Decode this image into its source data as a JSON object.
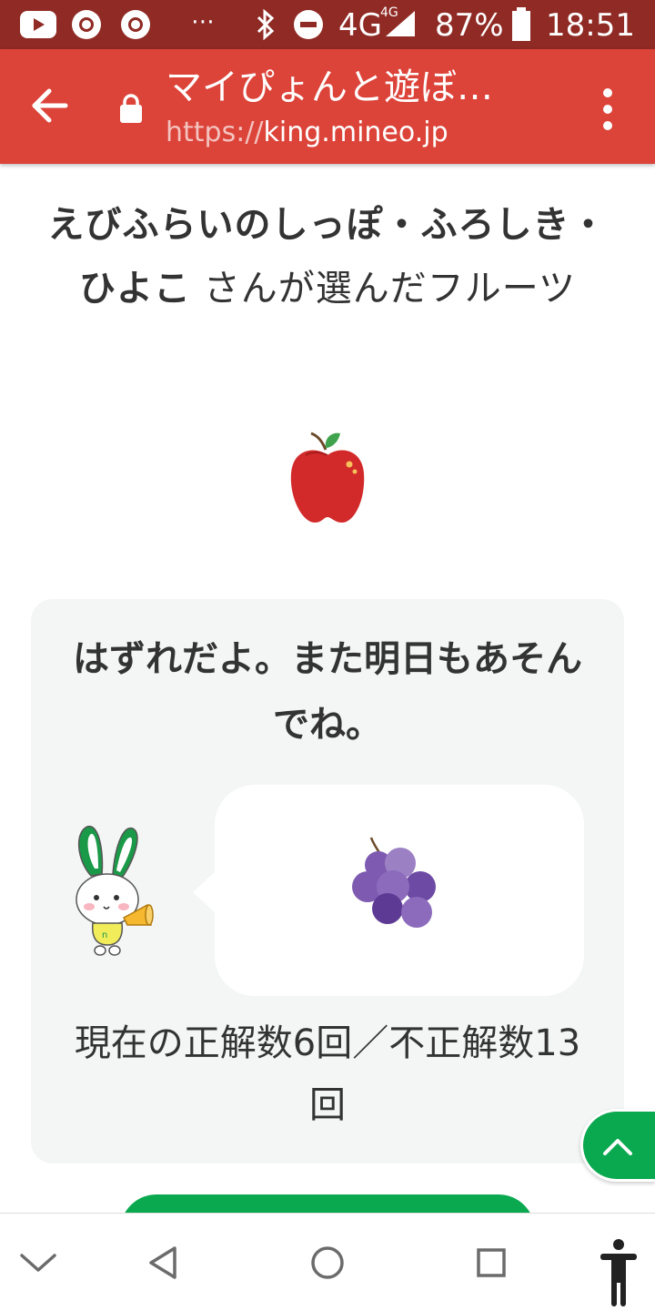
{
  "status_bar": {
    "icons": [
      "youtube-icon",
      "chrome-icon",
      "chrome-icon",
      "more-notifications-icon",
      "bluetooth-icon",
      "do-not-disturb-icon",
      "signal-icon",
      "battery-icon"
    ],
    "network": "4G",
    "network_small": "4G",
    "battery": "87%",
    "time": "18:51",
    "more": "⋯"
  },
  "browser": {
    "title": "マイぴょんと遊ぼ…",
    "url_scheme": "https://",
    "url_host": "king.mineo.jp"
  },
  "content": {
    "heading_name": "えびふらいのしっぽ・ふろしき・ひよこ",
    "heading_suffix": " さんが選んだフルーツ",
    "chosen_fruit": "apple-icon",
    "result": {
      "message": "はずれだよ。また明日もあそんでね。",
      "mascot": "mascot-icon",
      "answer_fruit": "grape-icon",
      "score": "現在の正解数6回／不正解数13回"
    }
  },
  "colors": {
    "status_bar": "#8f2a24",
    "url_bar": "#dc4339",
    "accent_green": "#0aa84f",
    "card_bg": "#f4f6f6"
  },
  "nav_bar": {
    "buttons": [
      "collapse-icon",
      "back-icon",
      "home-icon",
      "recents-icon",
      "accessibility-icon"
    ]
  }
}
